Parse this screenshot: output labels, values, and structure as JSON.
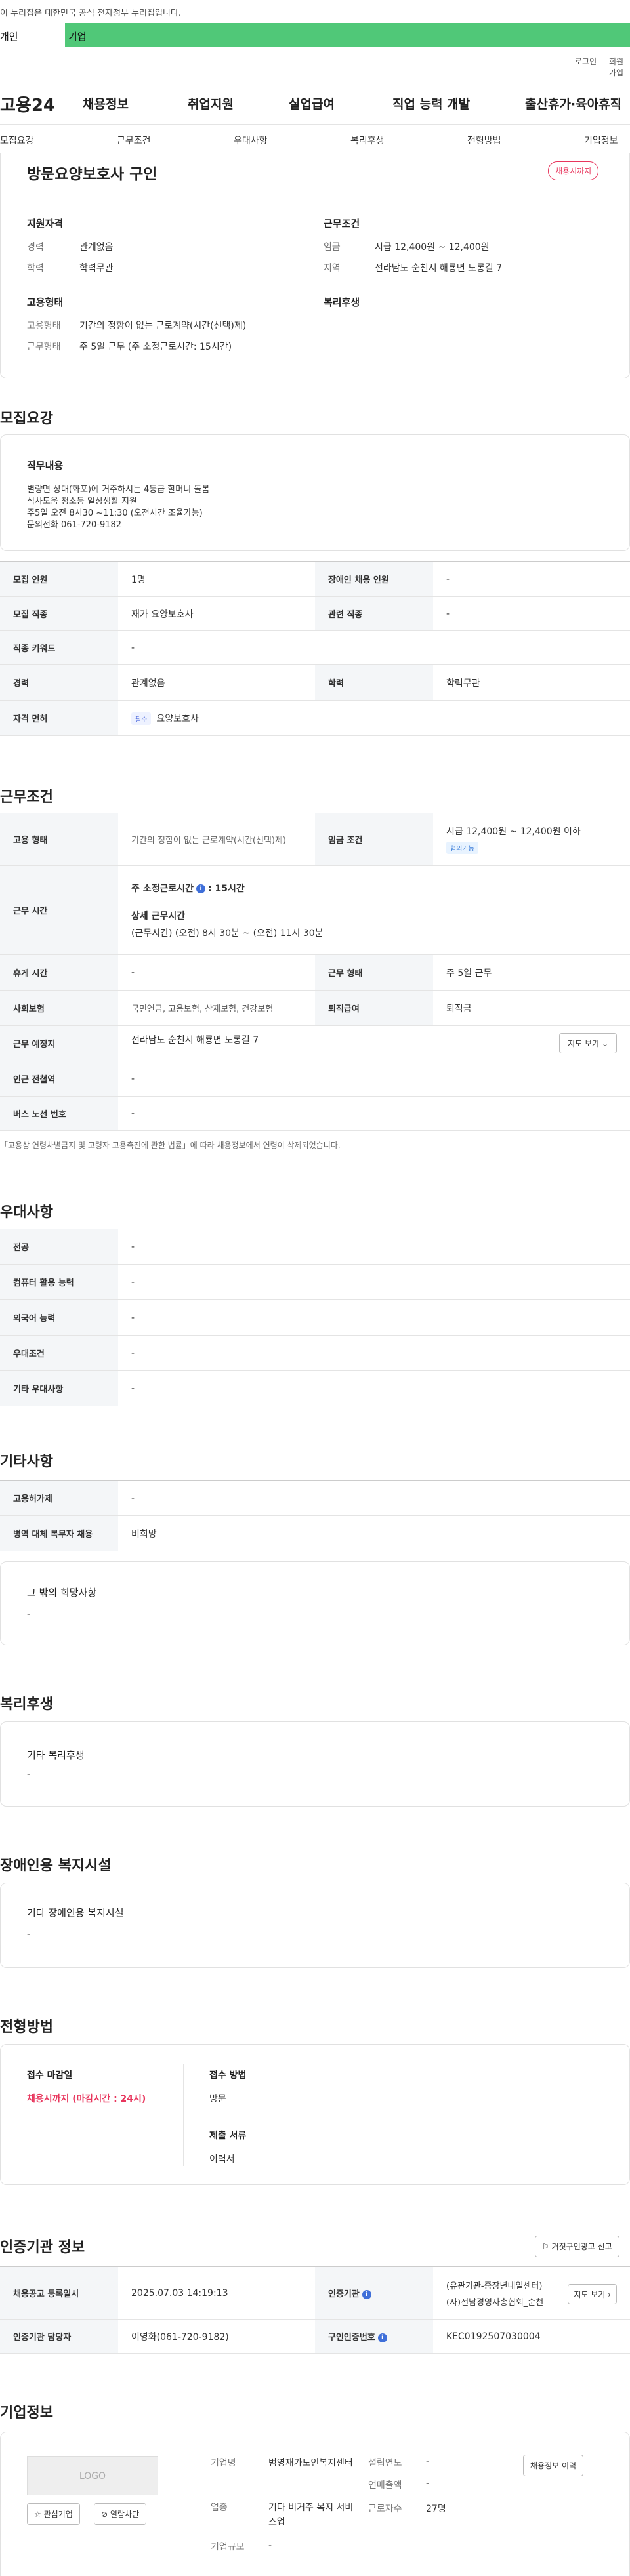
{
  "top_notice": "이 누리집은 대한민국 공식 전자정부 누리집입니다.",
  "tabs": {
    "personal": "개인",
    "company": "기업"
  },
  "util": {
    "login": "로그인",
    "join": "회원가입"
  },
  "gnb": {
    "logo": "고용24",
    "menu": [
      "채용정보",
      "취업지원",
      "실업급여",
      "직업 능력 개발",
      "출산휴가·육아휴직"
    ]
  },
  "snb": [
    "모집요강",
    "근무조건",
    "우대사항",
    "복리후생",
    "전형방법",
    "기업정보"
  ],
  "summary": {
    "title": "방문요양보호사 구인",
    "badge": "채용시까지",
    "qual_title": "지원자격",
    "qual": [
      {
        "label": "경력",
        "value": "관계없음"
      },
      {
        "label": "학력",
        "value": "학력무관"
      }
    ],
    "cond_title": "근무조건",
    "cond": [
      {
        "label": "임금",
        "value": "시급 12,400원 ~ 12,400원"
      },
      {
        "label": "지역",
        "value": "전라남도 순천시 해룡면 도롱길 7"
      }
    ],
    "emp_title": "고용형태",
    "emp": [
      {
        "label": "고용형태",
        "value": "기간의 정함이 없는 근로계약(시간(선택)제)"
      },
      {
        "label": "근무형태",
        "value": "주 5일 근무 (주 소정근로시간: 15시간)"
      }
    ],
    "welfare_title": "복리후생"
  },
  "recruit": {
    "section_title": "모집요강",
    "duty_title": "직무내용",
    "duty_lines": [
      "별량면 상대(화포)에 거주하시는 4등급 할머니 돌봄",
      "식사도움 청소등 일상생활 지원",
      "주5일 오전 8시30 ~11:30 (오전시간 조율가능)",
      "문의전화 061-720-9182"
    ],
    "rows": [
      {
        "l1": "모집 인원",
        "v1": "1명",
        "l2": "장애인 채용 인원",
        "v2": "-"
      },
      {
        "l1": "모집 직종",
        "v1": "재가 요양보호사",
        "l2": "관련 직종",
        "v2": "-"
      },
      {
        "l1": "직종 키워드",
        "v1": "-"
      },
      {
        "l1": "경력",
        "v1": "관계없음",
        "l2": "학력",
        "v2": "학력무관"
      },
      {
        "l1": "자격 면허",
        "badge": "필수",
        "v1": "요양보호사"
      }
    ]
  },
  "work": {
    "section_title": "근무조건",
    "emp_label": "고용 형태",
    "emp_value": "기간의 정함이 없는 근로계약(시간(선택)제)",
    "wage_label": "임금 조건",
    "wage_value": "시급 12,400원 ~ 12,400원 이하",
    "wage_badge": "협의가능",
    "time_label": "근무 시간",
    "time_week_title": "주 소정근로시간",
    "time_week_value": ": 15시간",
    "time_detail_title": "상세 근무시간",
    "time_detail_value": "(근무시간) (오전) 8시 30분 ~ (오전) 11시 30분",
    "rest_label": "휴게 시간",
    "rest_value": "-",
    "type_label": "근무 형태",
    "type_value": "주 5일 근무",
    "ins_label": "사회보험",
    "ins_value": "국민연금, 고용보험, 산재보험, 건강보험",
    "ret_label": "퇴직급여",
    "ret_value": "퇴직금",
    "place_label": "근무 예정지",
    "place_value": "전라남도 순천시 해룡면 도롱길 7",
    "map_btn": "지도 보기",
    "subway_label": "인근 전철역",
    "subway_value": "-",
    "bus_label": "버스 노선 번호",
    "bus_value": "-",
    "note": "「고용상 연령차별금지 및 고령자 고용촉진에 관한 법률」에 따라 채용정보에서 연령이 삭제되었습니다."
  },
  "pref": {
    "section_title": "우대사항",
    "rows": [
      {
        "l": "전공",
        "v": "-"
      },
      {
        "l": "컴퓨터 활용 능력",
        "v": "-"
      },
      {
        "l": "외국어 능력",
        "v": "-"
      },
      {
        "l": "우대조건",
        "v": "-"
      },
      {
        "l": "기타 우대사항",
        "v": "-"
      }
    ]
  },
  "etc": {
    "section_title": "기타사항",
    "rows": [
      {
        "l": "고용허가제",
        "v": "-"
      },
      {
        "l": "병역 대체 복무자 채용",
        "v": "비희망"
      }
    ],
    "hope_title": "그 밖의 희망사항",
    "hope_value": "-"
  },
  "welfare": {
    "section_title": "복리후생",
    "box_title": "기타 복리후생",
    "box_value": "-"
  },
  "disabled": {
    "section_title": "장애인용 복지시설",
    "box_title": "기타 장애인용 복지시설",
    "box_value": "-"
  },
  "process": {
    "section_title": "전형방법",
    "deadline_title": "접수 마감일",
    "deadline_value": "채용시까지 (마감시간 : 24시)",
    "method_title": "접수 방법",
    "method_value": "방문",
    "docs_title": "제출 서류",
    "docs_value": "이력서"
  },
  "agency": {
    "section_title": "인증기관 정보",
    "report_btn": "거짓구인광고 신고",
    "reg_label": "채용공고 등록일시",
    "reg_value": "2025.07.03 14:19:13",
    "agency_label": "인증기관",
    "agency_value1": "(유관기관-중장년내일센터)",
    "agency_value2": "(사)전남경영자총협회_순천",
    "map_btn": "지도 보기",
    "mgr_label": "인증기관 담당자",
    "mgr_value": "이영화(061-720-9182)",
    "cert_label": "구인인증번호",
    "cert_value": "KEC0192507030004"
  },
  "company": {
    "section_title": "기업정보",
    "logo": "LOGO",
    "fav_btn": "관심기업",
    "block_btn": "열람차단",
    "history_btn": "채용정보 이력",
    "fields": [
      {
        "l": "기업명",
        "v": "범영재가노인복지센터"
      },
      {
        "l": "업종",
        "v": "기타 비거주 복지 서비스업"
      },
      {
        "l": "기업규모",
        "v": "-"
      }
    ],
    "fields2": [
      {
        "l": "설립연도",
        "v": "-"
      },
      {
        "l": "연매출액",
        "v": "-"
      },
      {
        "l": "근로자수",
        "v": "27명"
      }
    ]
  }
}
